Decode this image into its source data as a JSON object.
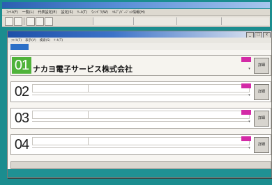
{
  "window": {
    "title": ""
  },
  "menubar": {
    "items": [
      "ﾌｧｲﾙ(F)",
      "一覧(L)",
      "代表設定(E)",
      "設定(S)",
      "ﾂｰﾙ(T)",
      "ｳｨﾝﾄﾞｳ(W)",
      "ﾍﾙﾌﾟ/ﾊﾞｰｼﾞｮﾝ情報(H)"
    ]
  },
  "child_window": {
    "title": "",
    "controls": {
      "minimize": "_",
      "maximize": "□",
      "close": "×"
    },
    "menu_items": [
      "ﾌｧｲﾙ(F)",
      "表示(V)",
      "検索(S)",
      "ﾂｰﾙ(T)"
    ],
    "active_tab": ""
  },
  "rows": [
    {
      "number": "01",
      "active": true,
      "header_fields": [
        "",
        "",
        ""
      ],
      "company_name": "ナカヨ電子サービス株式会社",
      "edit_label": "詳細"
    },
    {
      "number": "02",
      "active": false,
      "company_name": "",
      "edit_label": "詳細"
    },
    {
      "number": "03",
      "active": false,
      "company_name": "",
      "edit_label": "詳細"
    },
    {
      "number": "04",
      "active": false,
      "company_name": "",
      "edit_label": "詳細"
    }
  ],
  "colors": {
    "background": "#1b8d8f",
    "active_number": "#4fb33a",
    "marker": "#d32aa6"
  },
  "icons": [
    "open-icon",
    "save-icon",
    "print-icon",
    "search-icon",
    "help-icon"
  ]
}
